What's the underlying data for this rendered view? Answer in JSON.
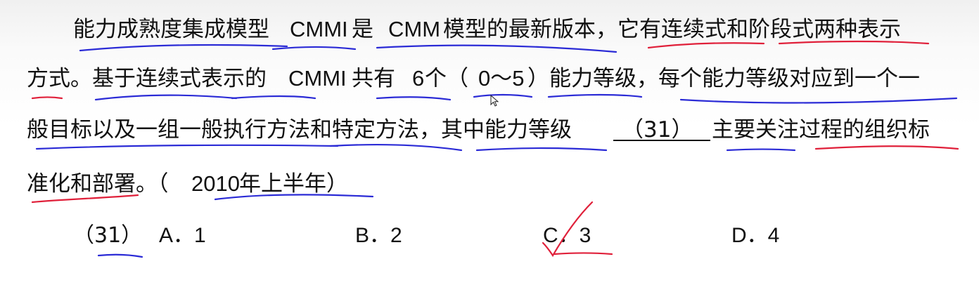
{
  "question": {
    "line1": {
      "p1": "能力成熟度集成模型 ",
      "p2": "CMMI",
      "p3": " 是 ",
      "p4": "CMM",
      "p5": " 模型的最新版本，它有连续式和阶段式两种表示"
    },
    "line2": {
      "p1": "方式。基于连续式表示的 ",
      "p2": "CMMI",
      "p3": " 共有 ",
      "p4": "6",
      "p5": " 个（",
      "p6": "0～5",
      "p7": "）能力等级，每个能力等级对应到一个一"
    },
    "line3": {
      "p1": "般目标以及一组一般执行方法和特定方法，其中能力等级",
      "p2": "（31）",
      "p3": "主要关注过程的组织标"
    },
    "line4": {
      "p1": "准化和部署。（",
      "p2": "2010",
      "p3": " 年上半年）"
    }
  },
  "options": {
    "number": "（31）",
    "a": "A．1",
    "b": "B．2",
    "c": "C．3",
    "d": "D．4"
  },
  "colors": {
    "text": "#111111",
    "blue_annotation": "#2b2bd6",
    "red_annotation": "#e0203a"
  }
}
